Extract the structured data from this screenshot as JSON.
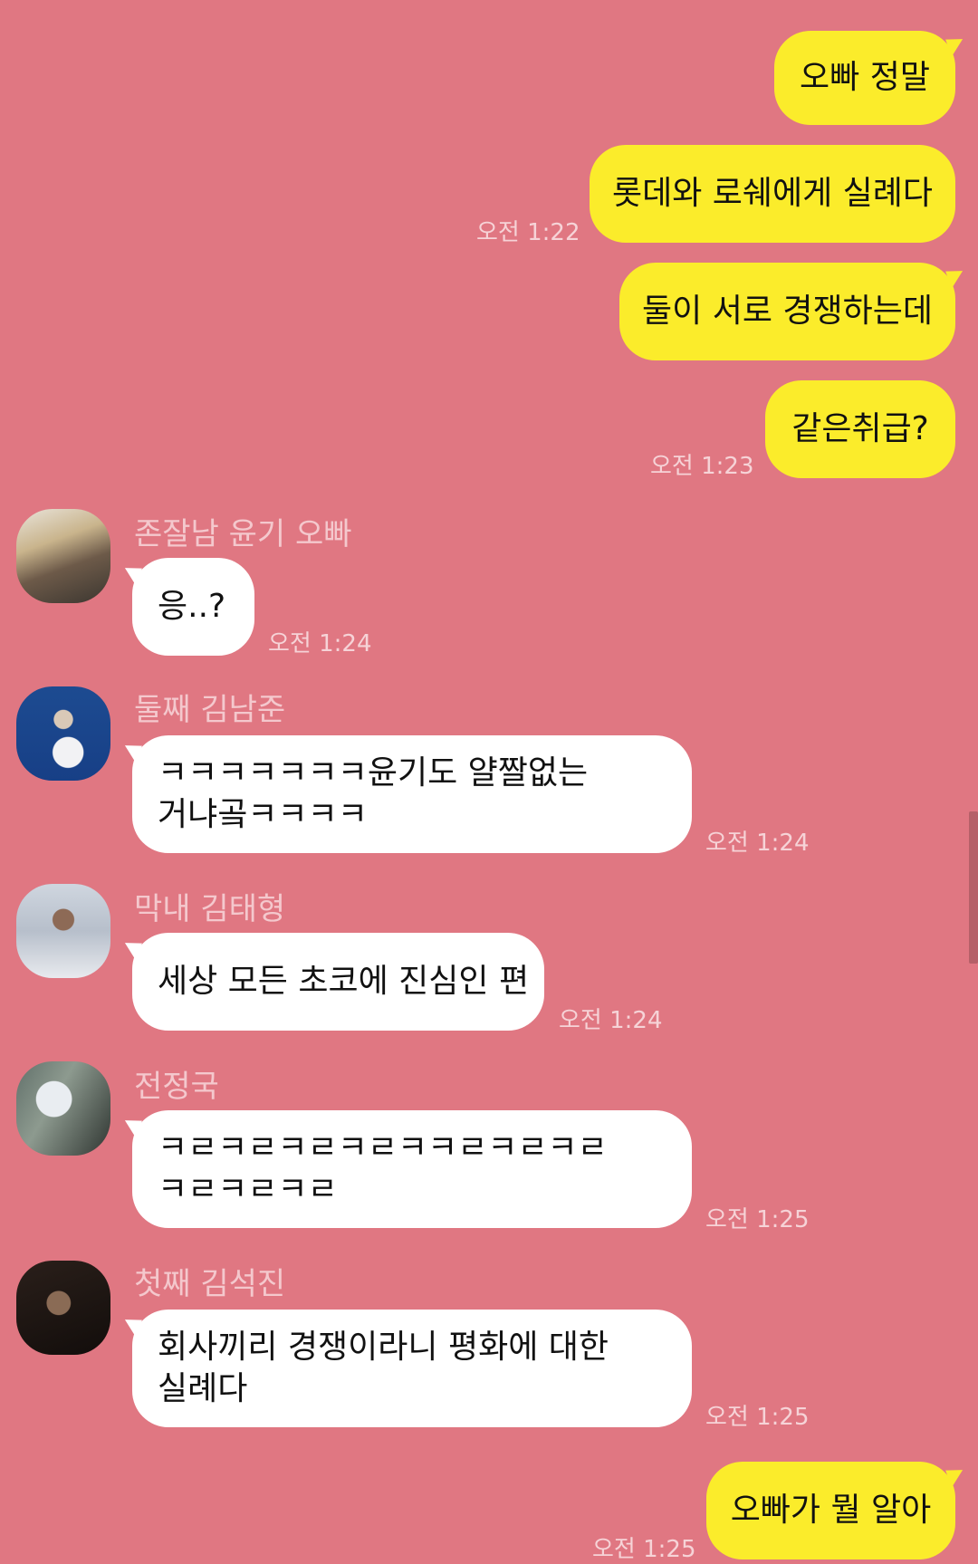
{
  "messages_me": [
    {
      "text": "오빠 정말"
    },
    {
      "text": "롯데와 로쉐에게 실례다",
      "time": "오전 1:22"
    },
    {
      "text": "둘이 서로 경쟁하는데"
    },
    {
      "text": "같은취급?",
      "time": "오전 1:23"
    }
  ],
  "messages_others": [
    {
      "name": "존잘남 윤기 오빠",
      "avatar": "profile-photo",
      "lines": [
        "응..?"
      ],
      "time": "오전 1:24"
    },
    {
      "name": "둘째 김남준",
      "avatar": "profile-photo",
      "lines": [
        "ㅋㅋㅋㅋㅋㅋㅋ윤기도 얄짤없는",
        "거냐곸ㅋㅋㅋㅋ"
      ],
      "time": "오전 1:24"
    },
    {
      "name": "막내 김태형",
      "avatar": "profile-photo",
      "lines": [
        "세상 모든 초코에 진심인 편"
      ],
      "time": "오전 1:24"
    },
    {
      "name": "전정국",
      "avatar": "profile-photo",
      "lines": [
        "ㅋㄹㅋㄹㅋㄹㅋㄹㅋㅋㄹㅋㄹㅋㄹ",
        "ㅋㄹㅋㄹㅋㄹ"
      ],
      "time": "오전 1:25"
    },
    {
      "name": "첫째 김석진",
      "avatar": "profile-photo",
      "lines": [
        "회사끼리 경쟁이라니 평화에 대한",
        "실례다"
      ],
      "time": "오전 1:25"
    }
  ],
  "last_me": {
    "text": "오빠가 뭘 알아",
    "time": "오전 1:25"
  },
  "colors": {
    "background": "#e07782",
    "my_bubble": "#fbec2b",
    "other_bubble": "#ffffff"
  }
}
